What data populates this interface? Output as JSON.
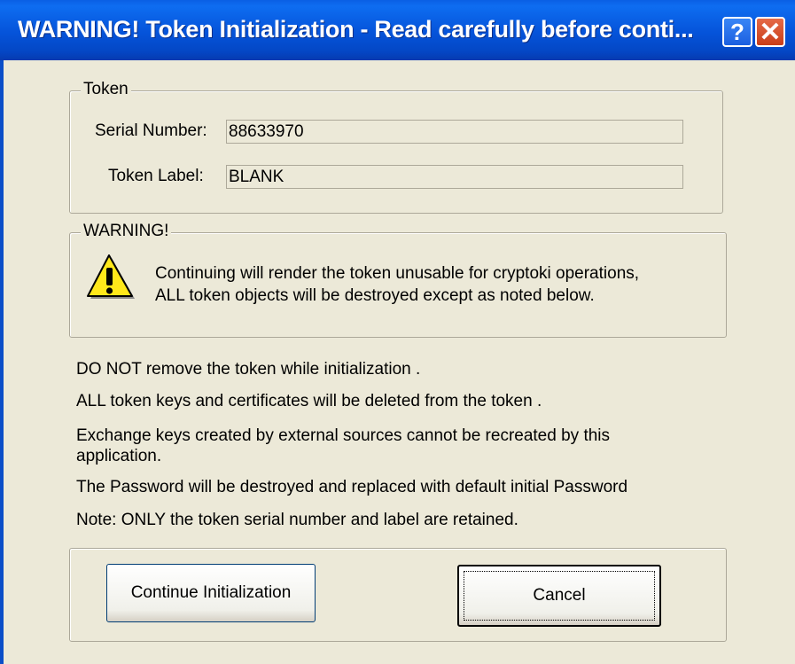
{
  "window": {
    "title": "WARNING!  Token Initialization  - Read carefully before conti...",
    "help_glyph": "?",
    "close_glyph": "✕"
  },
  "token_group": {
    "legend": "Token",
    "serial_label": "Serial Number:",
    "serial_value": "88633970",
    "label_label": "Token Label:",
    "label_value": "BLANK"
  },
  "warning_group": {
    "legend": "WARNING!",
    "icon": "warning-icon",
    "line1": "Continuing will render the token unusable for cryptoki operations,",
    "line2": "ALL token objects will be destroyed except as noted below."
  },
  "notes": [
    "DO NOT remove the token while initialization .",
    "ALL token keys and certificates will be deleted from the token .",
    "Exchange keys created by external sources cannot be recreated by this",
    "application.",
    "The Password will be destroyed and replaced with default initial Password",
    "Note: ONLY the token serial number and label are retained."
  ],
  "buttons": {
    "continue_label": "Continue Initialization",
    "cancel_label": "Cancel"
  },
  "colors": {
    "titlebar": "#0553d9",
    "dialog_bg": "#ece9d8",
    "close_button": "#c93d18",
    "warning_yellow": "#ffe81a"
  }
}
